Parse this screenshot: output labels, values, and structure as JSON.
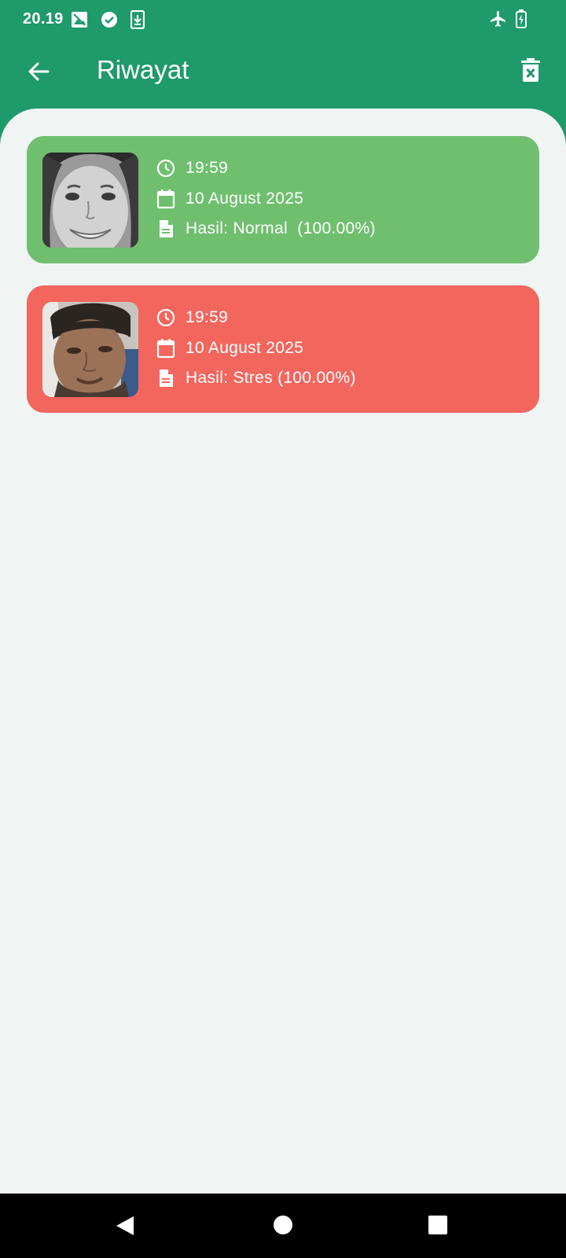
{
  "status_bar": {
    "time": "20.19",
    "left_icons": [
      "photo-icon",
      "check-circle-icon",
      "download-icon"
    ],
    "right_icons": [
      "airplane-icon",
      "battery-charging-icon"
    ]
  },
  "app_bar": {
    "title": "Riwayat",
    "back_icon": "arrow-back-icon",
    "delete_icon": "delete-sweep-icon"
  },
  "colors": {
    "primary": "#1f9a6b",
    "background": "#f0f5f3",
    "normal_card": "#6fbf6f",
    "stress_card": "#f2665e"
  },
  "history": [
    {
      "time": "19:59",
      "date": "10 August 2025",
      "result": "Hasil: Normal  (100.00%)",
      "status": "normal"
    },
    {
      "time": "19:59",
      "date": "10 August 2025",
      "result": "Hasil: Stres (100.00%)",
      "status": "stress"
    }
  ],
  "nav_bar": {
    "buttons": [
      "back-triangle-icon",
      "home-circle-icon",
      "recents-square-icon"
    ]
  }
}
